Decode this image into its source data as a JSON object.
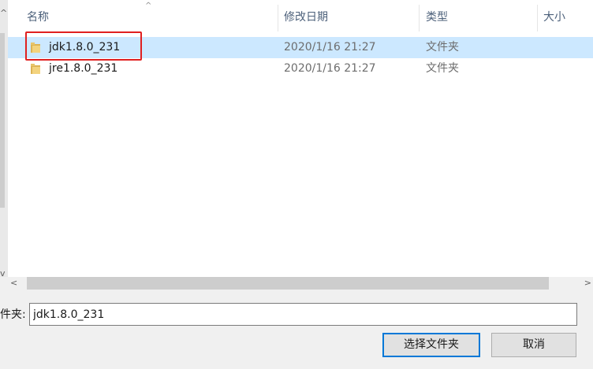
{
  "columns": {
    "name": "名称",
    "modified": "修改日期",
    "type": "类型",
    "size": "大小"
  },
  "rows": [
    {
      "name": "jdk1.8.0_231",
      "modified": "2020/1/16 21:27",
      "type": "文件夹",
      "selected": true
    },
    {
      "name": "jre1.8.0_231",
      "modified": "2020/1/16 21:27",
      "type": "文件夹",
      "selected": false
    }
  ],
  "footer": {
    "folder_label": "件夹:",
    "folder_value": "jdk1.8.0_231",
    "select_button": "选择文件夹",
    "cancel_button": "取消"
  },
  "icons": {
    "folder": "folder-icon",
    "sort": "sort-up-icon"
  },
  "colors": {
    "selection": "#cce8ff",
    "highlight": "#e02020",
    "accent": "#0078d7",
    "header_text": "#4c607a"
  }
}
